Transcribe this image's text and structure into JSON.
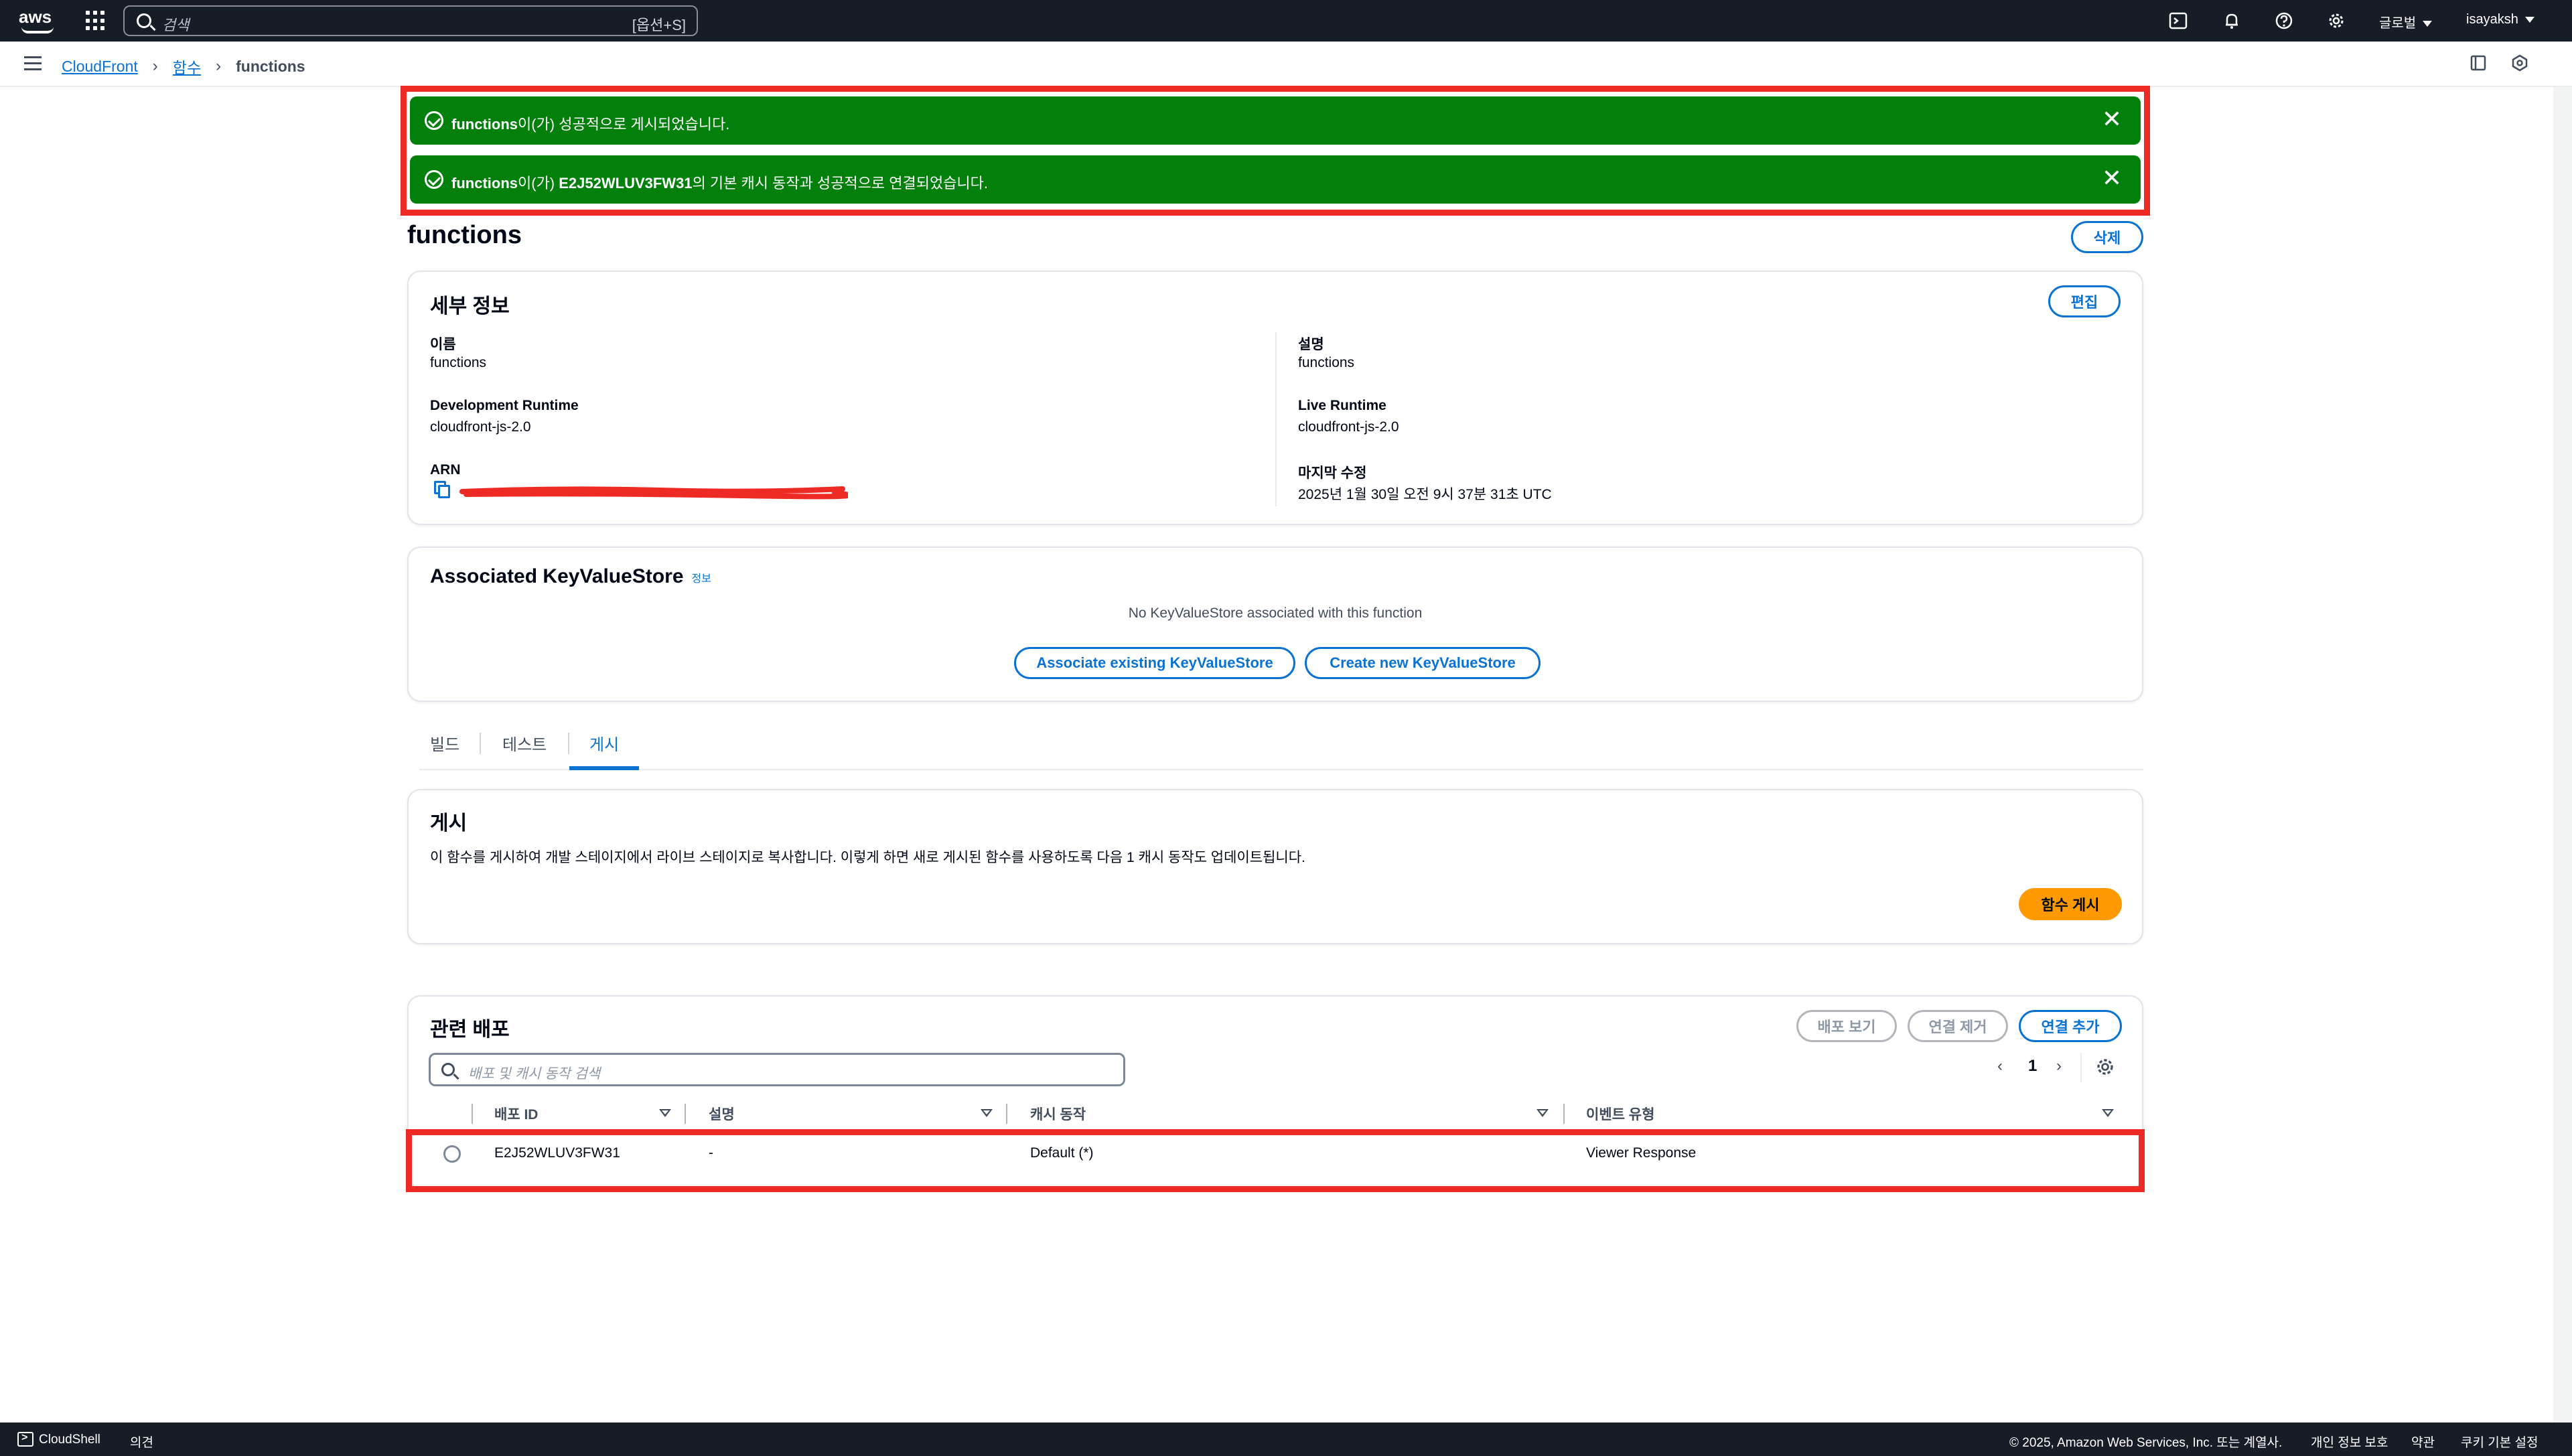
{
  "topnav": {
    "search_placeholder": "검색",
    "search_shortcut": "[옵션+S]",
    "region": "글로벌",
    "user": "isayaksh"
  },
  "breadcrumb": {
    "items": [
      "CloudFront",
      "함수"
    ],
    "current": "functions"
  },
  "flash": [
    {
      "prefix": "functions",
      "text": "이(가) 성공적으로 게시되었습니다."
    },
    {
      "prefix": "functions",
      "text_1": "이(가) ",
      "id": "E2J52WLUV3FW31",
      "text_2": "의 기본 캐시 동작과 성공적으로 연결되었습니다."
    }
  ],
  "page": {
    "title": "functions",
    "delete_label": "삭제"
  },
  "details": {
    "heading": "세부 정보",
    "edit_label": "편집",
    "name_label": "이름",
    "name_value": "functions",
    "dev_runtime_label": "Development Runtime",
    "dev_runtime_value": "cloudfront-js-2.0",
    "arn_label": "ARN",
    "desc_label": "설명",
    "desc_value": "functions",
    "live_runtime_label": "Live Runtime",
    "live_runtime_value": "cloudfront-js-2.0",
    "modified_label": "마지막 수정",
    "modified_value": "2025년 1월 30일 오전 9시 37분 31초 UTC"
  },
  "kvs": {
    "heading": "Associated KeyValueStore",
    "info": "정보",
    "empty_text": "No KeyValueStore associated with this function",
    "associate_label": "Associate existing KeyValueStore",
    "create_label": "Create new KeyValueStore"
  },
  "tabs": [
    "빌드",
    "테스트",
    "게시"
  ],
  "publish": {
    "heading": "게시",
    "description": "이 함수를 게시하여 개발 스테이지에서 라이브 스테이지로 복사합니다. 이렇게 하면 새로 게시된 함수를 사용하도록 다음 1 캐시 동작도 업데이트됩니다.",
    "button_label": "함수 게시"
  },
  "related": {
    "heading": "관련 배포",
    "view_label": "배포 보기",
    "remove_label": "연결 제거",
    "add_label": "연결 추가",
    "search_placeholder": "배포 및 캐시 동작 검색",
    "page": "1",
    "columns": [
      "배포 ID",
      "설명",
      "캐시 동작",
      "이벤트 유형"
    ],
    "rows": [
      {
        "id": "E2J52WLUV3FW31",
        "description": "-",
        "behavior": "Default (*)",
        "event": "Viewer Response"
      }
    ]
  },
  "footer": {
    "cloudshell": "CloudShell",
    "feedback": "의견",
    "copyright": "© 2025, Amazon Web Services, Inc. 또는 계열사.",
    "privacy": "개인 정보 보호",
    "terms": "약관",
    "cookies": "쿠키 기본 설정"
  },
  "colors": {
    "nav_bg": "#161d26",
    "link": "#0972d3",
    "success": "#037f0c",
    "primary_button": "#ff9900",
    "highlight": "#ee2a24"
  }
}
